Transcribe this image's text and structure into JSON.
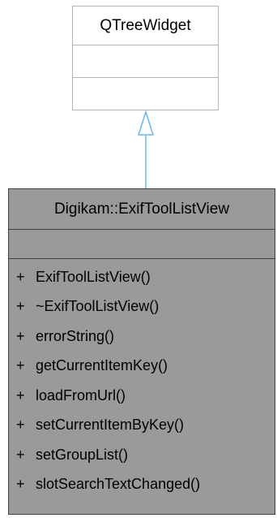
{
  "base_class": {
    "name": "QTreeWidget"
  },
  "derived_class": {
    "name": "Digikam::ExifToolListView",
    "methods": [
      {
        "visibility": "+",
        "name": "ExifToolListView()"
      },
      {
        "visibility": "+",
        "name": "~ExifToolListView()"
      },
      {
        "visibility": "+",
        "name": "errorString()"
      },
      {
        "visibility": "+",
        "name": "getCurrentItemKey()"
      },
      {
        "visibility": "+",
        "name": "loadFromUrl()"
      },
      {
        "visibility": "+",
        "name": "setCurrentItemByKey()"
      },
      {
        "visibility": "+",
        "name": "setGroupList()"
      },
      {
        "visibility": "+",
        "name": "slotSearchTextChanged()"
      }
    ]
  },
  "colors": {
    "base_fill": "#ffffff",
    "base_border": "#b5b5b5",
    "class_fill": "#9a9a9a",
    "class_border": "#404040",
    "arrow": "#63b8ff"
  }
}
